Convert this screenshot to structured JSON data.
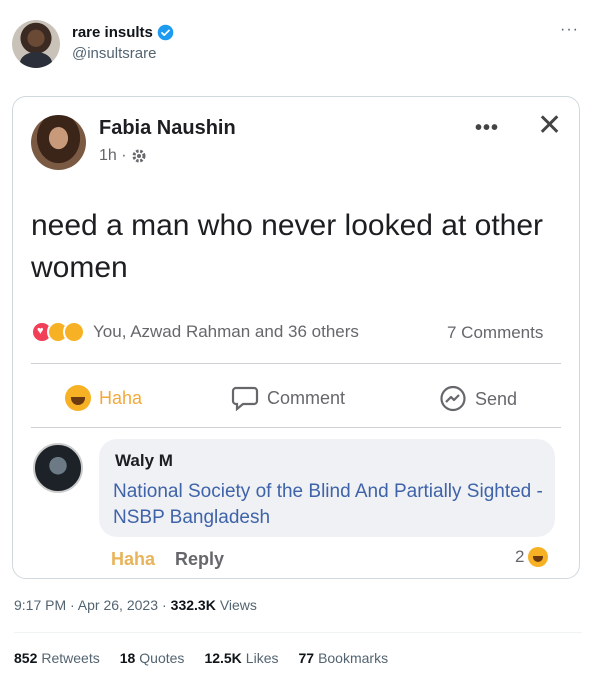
{
  "tweet": {
    "author_name": "rare insults",
    "author_handle": "@insultsrare",
    "verified": true,
    "more_label": "···",
    "timestamp": "9:17 PM · Apr 26, 2023",
    "views_count": "332.3K",
    "views_label": "Views",
    "stats": [
      {
        "count": "852",
        "label": "Retweets"
      },
      {
        "count": "18",
        "label": "Quotes"
      },
      {
        "count": "12.5K",
        "label": "Likes"
      },
      {
        "count": "77",
        "label": "Bookmarks"
      }
    ]
  },
  "fb_post": {
    "author_name": "Fabia Naushin",
    "time": "1h ·",
    "more_label": "•••",
    "close_label": "✕",
    "text": "need a man who never looked at other women",
    "reactions_text": "You, Azwad Rahman and 36 others",
    "comments_count": "7 Comments",
    "actions": {
      "haha": "Haha",
      "comment": "Comment",
      "send": "Send"
    },
    "comment": {
      "author": "Waly M",
      "text": "National Society of the Blind And Partially Sighted - NSBP Bangladesh",
      "haha": "Haha",
      "reply": "Reply",
      "reaction_count": "2"
    }
  },
  "colors": {
    "twitter_blue": "#1d9bf0",
    "fb_link": "#3f63a8",
    "haha_yellow": "#f7b125"
  }
}
